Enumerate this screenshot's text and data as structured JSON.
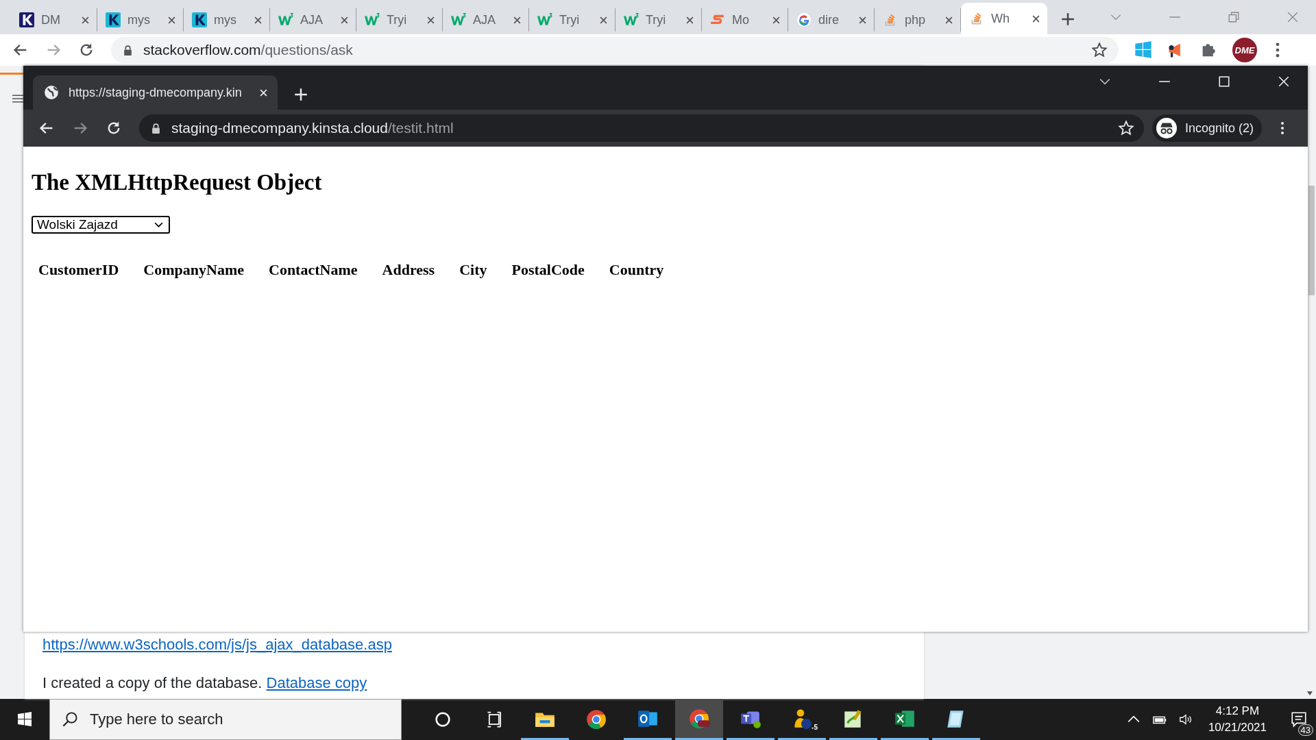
{
  "browser": {
    "tabs": [
      {
        "title": "DM",
        "kind": "k-dark",
        "selected": false
      },
      {
        "title": "mys",
        "kind": "k-teal",
        "selected": false
      },
      {
        "title": "mys",
        "kind": "k-teal",
        "selected": false
      },
      {
        "title": "AJA",
        "kind": "w3",
        "selected": false
      },
      {
        "title": "Tryi",
        "kind": "w3",
        "selected": false
      },
      {
        "title": "AJA",
        "kind": "w3",
        "selected": false
      },
      {
        "title": "Tryi",
        "kind": "w3",
        "selected": false
      },
      {
        "title": "Tryi",
        "kind": "w3",
        "selected": false
      },
      {
        "title": "Mo",
        "kind": "s-orange",
        "selected": false
      },
      {
        "title": "dire",
        "kind": "google",
        "selected": false
      },
      {
        "title": "php",
        "kind": "stack",
        "selected": false
      },
      {
        "title": "Wh",
        "kind": "stack",
        "selected": true
      }
    ],
    "address": {
      "host": "stackoverflow.com",
      "path": "/questions/ask"
    },
    "profile_label": "DME"
  },
  "incognito_window": {
    "tab": {
      "title": "https://staging-dmecompany.kin"
    },
    "address": {
      "host": "staging-dmecompany.kinsta.cloud",
      "path": "/testit.html"
    },
    "profile_label": "Incognito (2)",
    "page": {
      "heading": "The XMLHttpRequest Object",
      "select": {
        "value": "Wolski Zajazd"
      },
      "table": {
        "columns": [
          "CustomerID",
          "CompanyName",
          "ContactName",
          "Address",
          "City",
          "PostalCode",
          "Country"
        ]
      }
    }
  },
  "page_below": {
    "link": "https://www.w3schools.com/js/js_ajax_database.asp",
    "sentence": "I created a copy of the database.",
    "sentence_link": "Database copy"
  },
  "taskbar": {
    "search": {
      "placeholder": "Type here to search"
    },
    "apps": [
      {
        "kind": "explorer",
        "running": true,
        "selected": false
      },
      {
        "kind": "chrome",
        "running": false,
        "selected": false
      },
      {
        "kind": "outlook",
        "running": true,
        "selected": false
      },
      {
        "kind": "chrome-dme",
        "running": true,
        "selected": true
      },
      {
        "kind": "teams",
        "running": true,
        "selected": false
      },
      {
        "kind": "duck",
        "running": true,
        "selected": false,
        "badge": "-5"
      },
      {
        "kind": "notepad",
        "running": true,
        "selected": false
      },
      {
        "kind": "excel",
        "running": true,
        "selected": false
      },
      {
        "kind": "pad",
        "running": true,
        "selected": false
      }
    ],
    "clock": {
      "time": "4:12 PM",
      "date": "10/21/2021"
    },
    "notifications": {
      "count": "43"
    }
  }
}
